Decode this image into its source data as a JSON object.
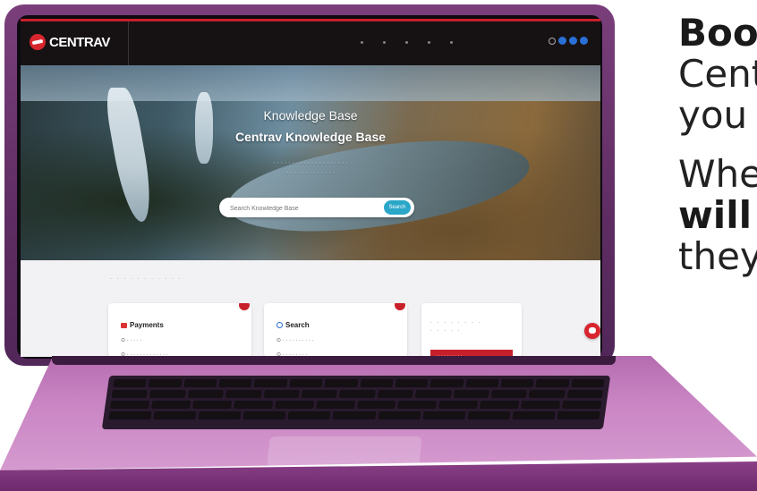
{
  "side_text": {
    "line1": "Boo",
    "line2": "Cent",
    "line3": "you",
    "line4": "Whe",
    "line5": "will",
    "line6": "they"
  },
  "site": {
    "logo_text": "CENTRAV",
    "hero_title": "Knowledge Base",
    "hero_subtitle": "Centrav Knowledge Base",
    "search_placeholder": "Search Knowledge Base",
    "search_button": "Search",
    "cards": [
      {
        "title": "Payments"
      },
      {
        "title": "Search"
      }
    ]
  },
  "colors": {
    "brand_red": "#c8202a",
    "laptop_purple": "#7a3f7b",
    "accent_blue": "#2aa7c8"
  },
  "icons": [
    "centrav-logo-icon",
    "search-icon",
    "chat-icon",
    "user-icon",
    "payments-icon"
  ]
}
